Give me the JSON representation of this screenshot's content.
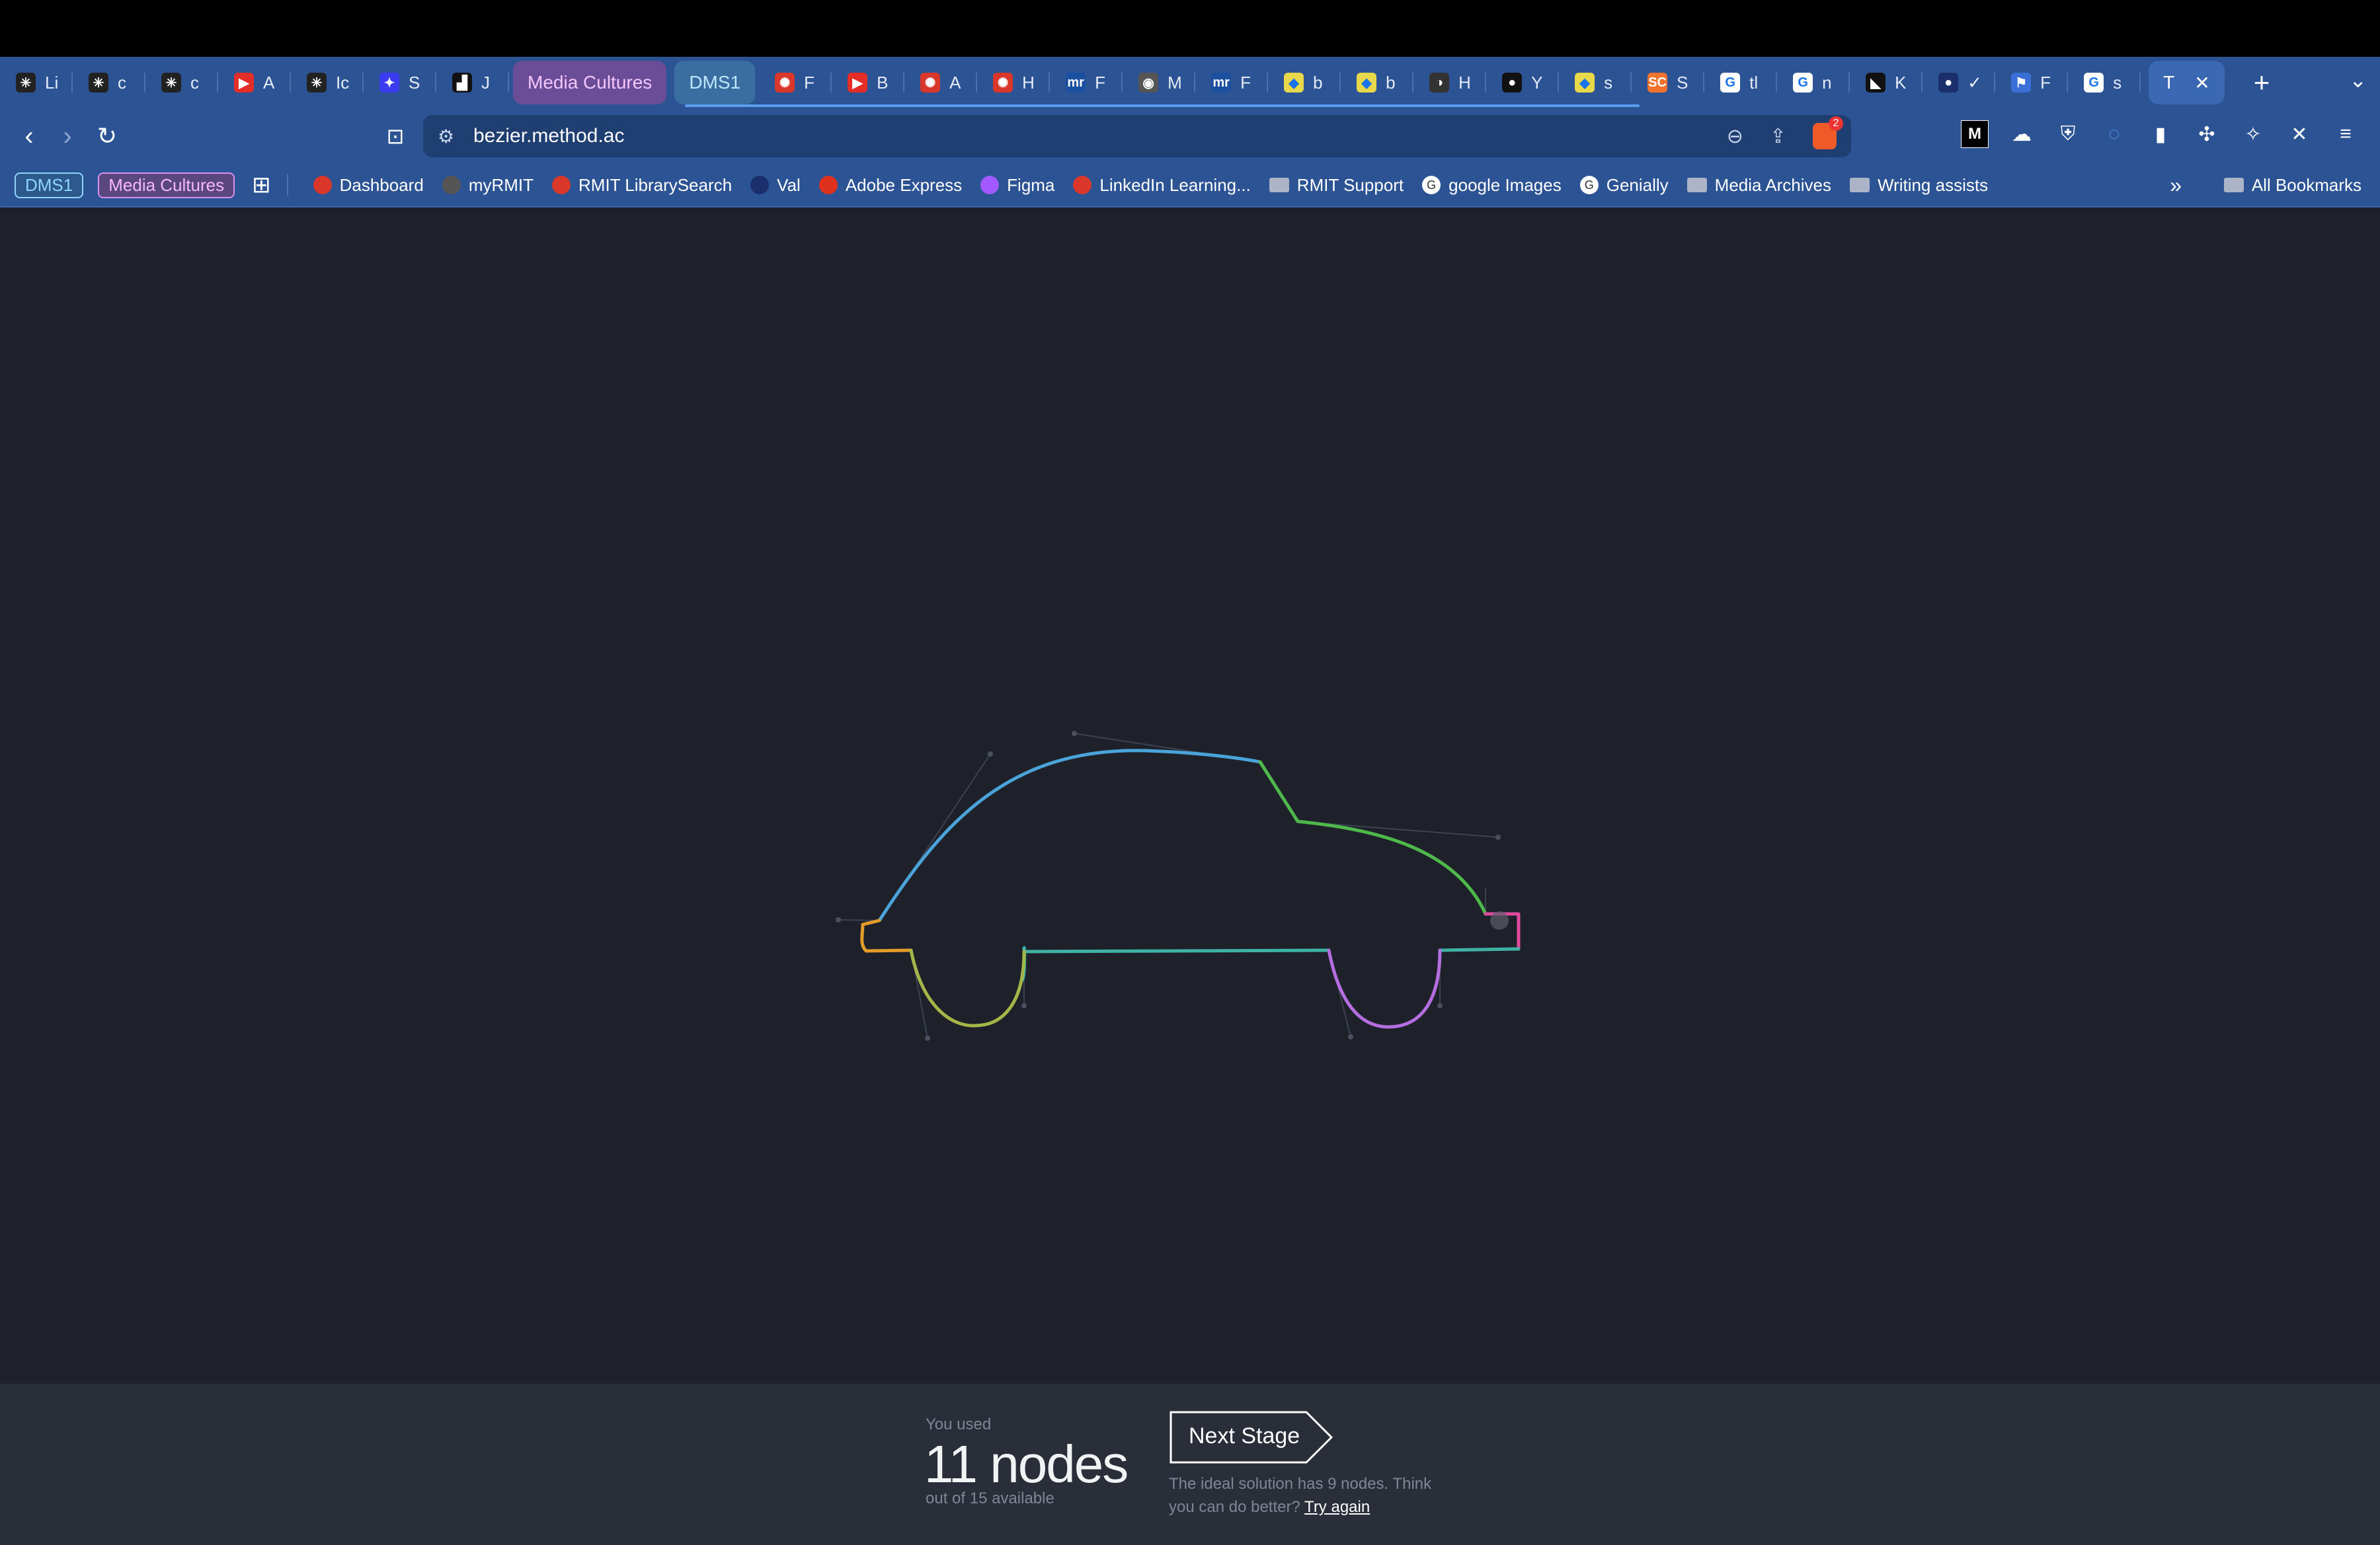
{
  "tabs": [
    {
      "letter": "Li",
      "color": "#222",
      "glyph": "✳"
    },
    {
      "letter": "c",
      "color": "#222",
      "glyph": "✳"
    },
    {
      "letter": "c",
      "color": "#222",
      "glyph": "✳"
    },
    {
      "letter": "A",
      "color": "#e52d27",
      "glyph": "▶"
    },
    {
      "letter": "Ic",
      "color": "#222",
      "glyph": "✳"
    },
    {
      "letter": "S",
      "color": "#3b3bf2",
      "glyph": "✦"
    },
    {
      "letter": "J",
      "color": "#111",
      "glyph": "▟"
    }
  ],
  "tab_groups": [
    {
      "label": "Media Cultures",
      "kind": "media"
    },
    {
      "label": "DMS1",
      "kind": "dms"
    }
  ],
  "tabs_after": [
    {
      "letter": "F",
      "color": "#d9372a",
      "glyph": "✺"
    },
    {
      "letter": "B",
      "color": "#e52d27",
      "glyph": "▶"
    },
    {
      "letter": "A",
      "color": "#d9372a",
      "glyph": "✺"
    },
    {
      "letter": "H",
      "color": "#d9372a",
      "glyph": "✺"
    },
    {
      "letter": "F",
      "color": "#1b4fa0",
      "glyph": "mr"
    },
    {
      "letter": "M",
      "color": "#555",
      "glyph": "◉"
    },
    {
      "letter": "F",
      "color": "#1b4fa0",
      "glyph": "mr"
    },
    {
      "letter": "b",
      "color": "#e8d84a",
      "glyph": "◆"
    },
    {
      "letter": "b",
      "color": "#e8d84a",
      "glyph": "◆"
    },
    {
      "letter": "H",
      "color": "#333",
      "glyph": "◑"
    },
    {
      "letter": "Y",
      "color": "#111",
      "glyph": "●"
    },
    {
      "letter": "s",
      "color": "#e8d84a",
      "glyph": "◆"
    },
    {
      "letter": "S",
      "color": "#f0722d",
      "glyph": "SC"
    },
    {
      "letter": "tl",
      "color": "#fff",
      "glyph": "G"
    },
    {
      "letter": "n",
      "color": "#fff",
      "glyph": "G"
    },
    {
      "letter": "K",
      "color": "#111",
      "glyph": "◣"
    },
    {
      "letter": "✓",
      "color": "#1a2f6b",
      "glyph": "●"
    },
    {
      "letter": "F",
      "color": "#3b6fd8",
      "glyph": "⚑"
    },
    {
      "letter": "s",
      "color": "#fff",
      "glyph": "G"
    }
  ],
  "active_tab": {
    "letter": "T",
    "close": "✕"
  },
  "new_tab": "+",
  "tab_list": "⌄",
  "nav": {
    "back": "‹",
    "forward": "›",
    "reload": "↻",
    "bookmark": "⊡"
  },
  "url": "bezier.method.ac",
  "brave_badge": "2",
  "bookmarks": {
    "groups": [
      "DMS1",
      "Media Cultures"
    ],
    "items": [
      {
        "label": "Dashboard",
        "icon_color": "#d9372a"
      },
      {
        "label": "myRMIT",
        "icon_color": "#555"
      },
      {
        "label": "RMIT LibrarySearch",
        "icon_color": "#d9372a"
      },
      {
        "label": "Val",
        "icon_color": "#1a2f6b"
      },
      {
        "label": "Adobe Express",
        "icon_color": "#e0301e"
      },
      {
        "label": "Figma",
        "icon_color": "#a259ff"
      },
      {
        "label": "LinkedIn Learning...",
        "icon_color": "#d9372a"
      }
    ],
    "folders_mixed": [
      {
        "label": "RMIT Support",
        "type": "folder"
      },
      {
        "label": "google Images",
        "type": "google"
      },
      {
        "label": "Genially",
        "type": "genially"
      },
      {
        "label": "Media Archives",
        "type": "folder"
      },
      {
        "label": "Writing assists",
        "type": "folder"
      }
    ],
    "more": "»",
    "all": "All Bookmarks"
  },
  "result": {
    "used_label": "You used",
    "count": "11 nodes",
    "out_of": "out of 15 available",
    "next_button": "Next Stage",
    "hint_text": "The ideal solution has 9 nodes. Think you can do better?",
    "try_again": "Try again"
  },
  "colors": {
    "canvas_bg": "#1e212a",
    "browser_chrome": "#2c5394",
    "segment_blue": "#4aa3d9",
    "segment_green": "#4fb84a",
    "segment_olive": "#a6b548",
    "segment_pink": "#e04a9e",
    "segment_purple": "#b46ee0",
    "segment_teal": "#3fb2a6",
    "segment_orange": "#e39b2a"
  }
}
